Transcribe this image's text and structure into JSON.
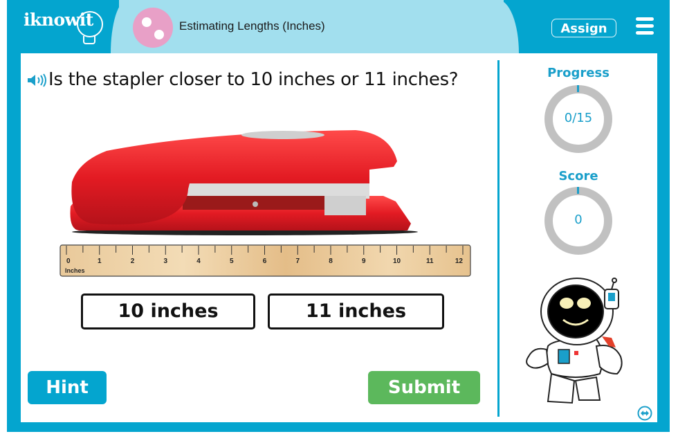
{
  "header": {
    "logo": "iknowit",
    "topic_title": "Estimating Lengths (Inches)",
    "assign_label": "Assign",
    "menu_icon": "hamburger-menu-icon",
    "topic_icon": "two-dots-circle-icon"
  },
  "question": {
    "audio_icon": "speaker-icon",
    "text": "Is the stapler closer to 10 inches or 11 inches?",
    "image": "red-stapler",
    "ruler": {
      "unit_label": "Inches",
      "ticks": [
        "0",
        "1",
        "2",
        "3",
        "4",
        "5",
        "6",
        "7",
        "8",
        "9",
        "10",
        "11",
        "12"
      ]
    }
  },
  "choices": [
    {
      "label": "10 inches"
    },
    {
      "label": "11 inches"
    }
  ],
  "actions": {
    "hint_label": "Hint",
    "submit_label": "Submit"
  },
  "sidebar": {
    "progress_label": "Progress",
    "progress_value": "0/15",
    "progress_fraction": 0,
    "score_label": "Score",
    "score_value": "0",
    "mascot": "astronaut-robot",
    "swap_icon": "swap-horizontal-icon"
  },
  "colors": {
    "brand_blue": "#04a5cf",
    "header_tab": "#a2dfee",
    "topic_pink": "#e8a0c7",
    "submit_green": "#5cb85c",
    "ring_gray": "#c1c1c1",
    "stapler_red": "#e31b23"
  }
}
